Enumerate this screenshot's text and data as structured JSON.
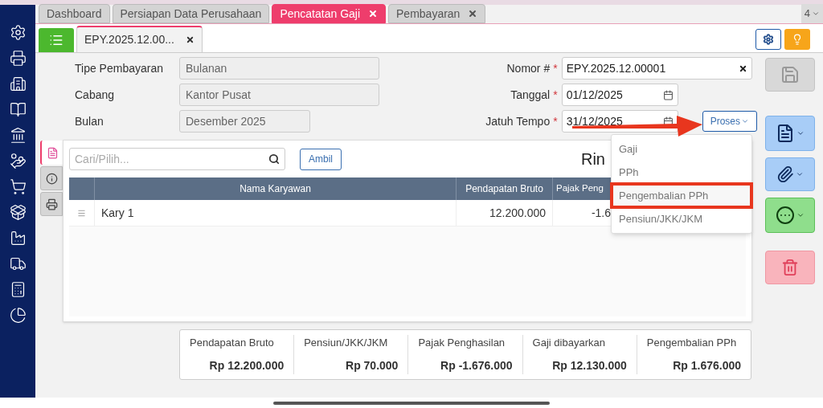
{
  "top_tabs": [
    {
      "label": "Dashboard",
      "selected": false,
      "closable": false
    },
    {
      "label": "Persiapan Data Perusahaan",
      "selected": false,
      "closable": false
    },
    {
      "label": "Pencatatan Gaji",
      "selected": true,
      "closable": true
    },
    {
      "label": "Pembayaran",
      "selected": false,
      "closable": true
    }
  ],
  "tab_count": "4",
  "doc_tab": {
    "label": "EPY.2025.12.00..."
  },
  "form_left": [
    {
      "label": "Tipe Pembayaran",
      "value": "Bulanan"
    },
    {
      "label": "Cabang",
      "value": "Kantor Pusat"
    },
    {
      "label": "Bulan",
      "value": "Desember 2025"
    }
  ],
  "form_right": [
    {
      "label": "Nomor #",
      "value": "EPY.2025.12.00001",
      "required_mark": "*",
      "kind": "clearable"
    },
    {
      "label": "Tanggal",
      "value": "01/12/2025",
      "required_mark": "*",
      "kind": "date"
    },
    {
      "label": "Jatuh Tempo",
      "value": "31/12/2025",
      "required_mark": "*",
      "kind": "date"
    }
  ],
  "proses_button": {
    "label": "Proses"
  },
  "proses_menu": [
    {
      "label": "Gaji",
      "selected": false
    },
    {
      "label": "PPh",
      "selected": false
    },
    {
      "label": "Pengembalian PPh",
      "selected": true
    },
    {
      "label": "Pensiun/JKK/JKM",
      "selected": false
    }
  ],
  "side_tabs": [
    {
      "kind": "document",
      "selected": true
    },
    {
      "kind": "info",
      "selected": false
    },
    {
      "kind": "print",
      "selected": false
    }
  ],
  "search": {
    "placeholder": "Cari/Pilih..."
  },
  "ambil_button": {
    "label": "Ambil"
  },
  "panel_title": "Rin",
  "table": {
    "columns": [
      "Nama Karyawan",
      "Pendapatan Bruto",
      "Pajak Peng"
    ],
    "rows": [
      {
        "cells": [
          "Kary 1",
          "12.200.000",
          "-1.6"
        ]
      }
    ]
  },
  "summary": [
    {
      "label": "Pendapatan Bruto",
      "value": "Rp 12.200.000"
    },
    {
      "label": "Pensiun/JKK/JKM",
      "value": "Rp 70.000"
    },
    {
      "label": "Pajak Penghasilan",
      "value": "Rp -1.676.000"
    },
    {
      "label": "Gaji dibayarkan",
      "value": "Rp 12.130.000"
    },
    {
      "label": "Pengembalian PPh",
      "value": "Rp 1.676.000"
    }
  ]
}
